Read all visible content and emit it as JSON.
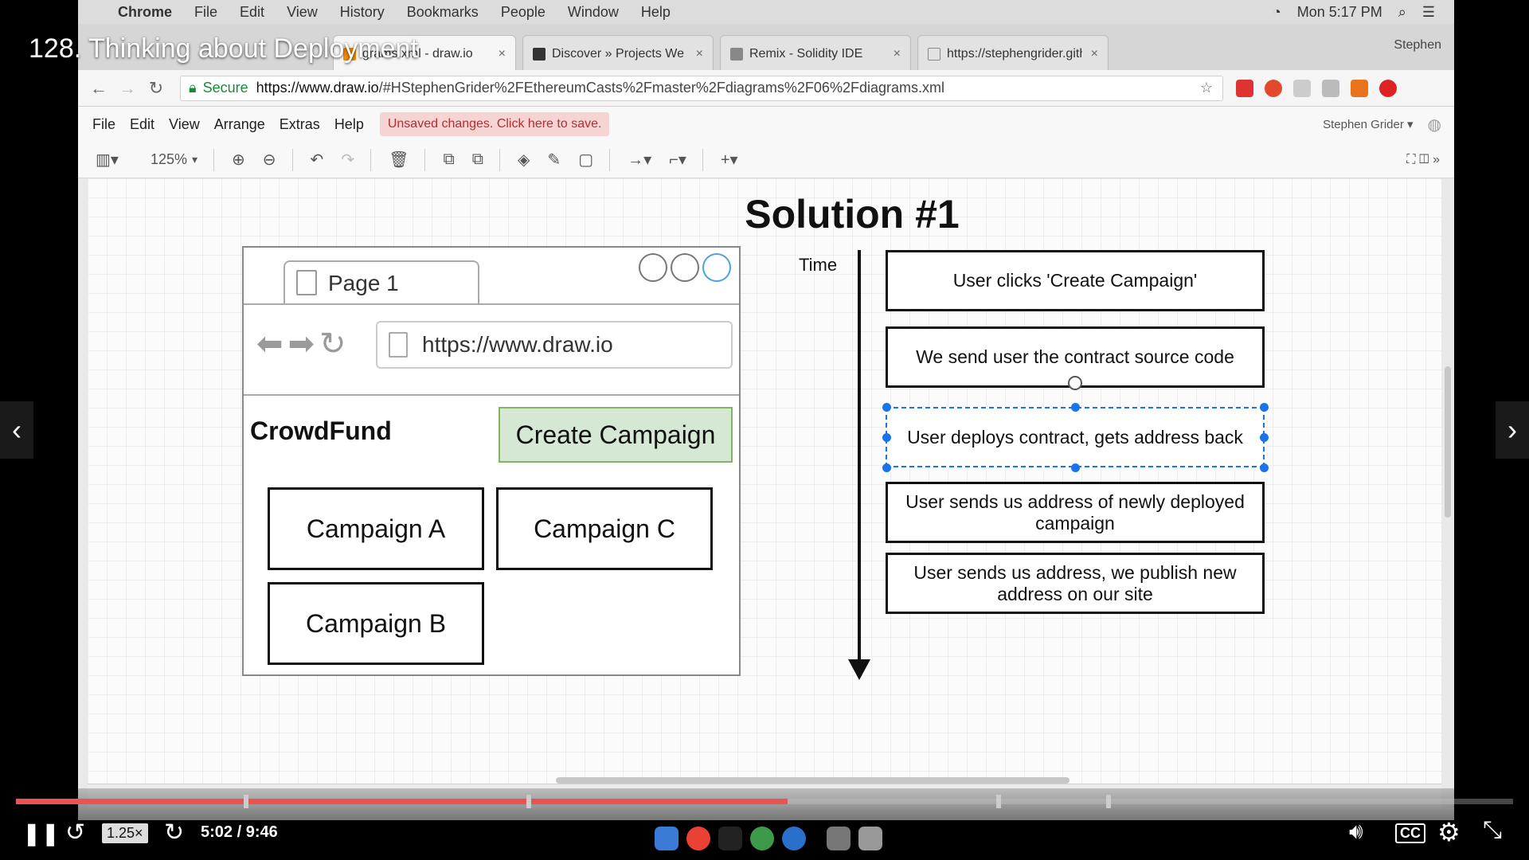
{
  "video": {
    "title": "128. Thinking about Deployment",
    "time": "5:02 / 9:46",
    "speed": "1.25×",
    "progress_fraction": 0.5154,
    "chapter_markers": [
      0.152,
      0.341,
      0.655,
      0.728
    ]
  },
  "mac_menubar": {
    "apple": "",
    "items": [
      "Chrome",
      "File",
      "Edit",
      "View",
      "History",
      "Bookmarks",
      "People",
      "Window",
      "Help"
    ],
    "clock": "Mon 5:17 PM"
  },
  "browser": {
    "tabs": [
      {
        "label": "grams.xml - draw.io",
        "active": true
      },
      {
        "label": "Discover » Projects We Love",
        "active": false
      },
      {
        "label": "Remix - Solidity IDE",
        "active": false
      },
      {
        "label": "https://stephengrider.github",
        "active": false
      }
    ],
    "profile": "Stephen",
    "secure_label": "Secure",
    "url_host": "https://www.draw.io",
    "url_rest": "/#HStephenGrider%2FEthereumCasts%2Fmaster%2Fdiagrams%2F06%2Fdiagrams.xml"
  },
  "drawio": {
    "menu": [
      "File",
      "Edit",
      "View",
      "Arrange",
      "Extras",
      "Help"
    ],
    "unsaved": "Unsaved changes. Click here to save.",
    "user": "Stephen Grider ▾",
    "zoom": "125%"
  },
  "diagram": {
    "title": "Solution #1",
    "mockup": {
      "tab_label": "Page 1",
      "url": "https://www.draw.io",
      "brand": "CrowdFund",
      "create_button": "Create Campaign",
      "campaigns": [
        "Campaign A",
        "Campaign C",
        "Campaign B"
      ]
    },
    "time_label": "Time",
    "steps": [
      "User clicks 'Create Campaign'",
      "We send user the contract source code",
      "User deploys contract, gets address back",
      "User sends us address of newly deployed campaign",
      "User sends us address, we publish new address on our site"
    ]
  },
  "colors": {
    "progress": "#ec5252",
    "create_button_fill": "#d5e8d4",
    "create_button_border": "#82b366",
    "selection": "#1a73e8",
    "unsaved_text": "#b03030"
  }
}
